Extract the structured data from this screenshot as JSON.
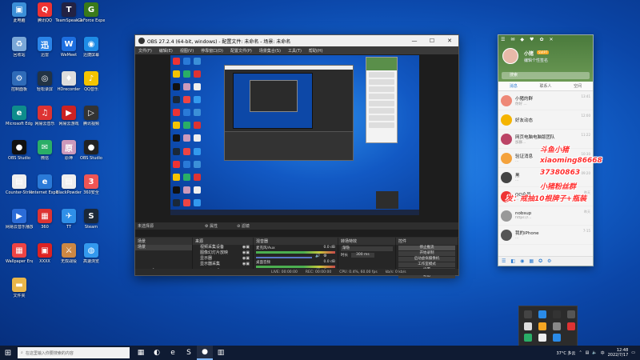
{
  "desktop": {
    "icons": [
      {
        "label": "此电脑",
        "color": "#3b8fd8",
        "glyph": "▣"
      },
      {
        "label": "腾讯QQ",
        "color": "#e33",
        "glyph": "Q"
      },
      {
        "label": "TeamSpeak 3",
        "color": "#224",
        "glyph": "T"
      },
      {
        "label": "GeForce Experience",
        "color": "#3a7a1a",
        "glyph": "G"
      },
      {
        "label": "回收站",
        "color": "#7aa7d8",
        "glyph": "♻"
      },
      {
        "label": "迅雷",
        "color": "#2a84e8",
        "glyph": "迅"
      },
      {
        "label": "WeMeet",
        "color": "#1d6fe0",
        "glyph": "W"
      },
      {
        "label": "迅捷屏幕",
        "color": "#1e8ce6",
        "glyph": "◉"
      },
      {
        "label": "控制面板",
        "color": "#2f6bb8",
        "glyph": "⚙"
      },
      {
        "label": "轻松录屏",
        "color": "#234",
        "glyph": "◎"
      },
      {
        "label": "HDrecorder",
        "color": "#ddd",
        "glyph": "♦"
      },
      {
        "label": "QQ音乐",
        "color": "#f5c400",
        "glyph": "♪"
      },
      {
        "label": "Microsoft Edge",
        "color": "#0e8c8c",
        "glyph": "e"
      },
      {
        "label": "网易云音乐",
        "color": "#d33",
        "glyph": "♫"
      },
      {
        "label": "网易云游戏",
        "color": "#c22",
        "glyph": "▶"
      },
      {
        "label": "腾讯视频",
        "color": "#333",
        "glyph": "▷"
      },
      {
        "label": "OBS Studio",
        "color": "#111",
        "glyph": "●"
      },
      {
        "label": "微信",
        "color": "#2aae67",
        "glyph": "✉"
      },
      {
        "label": "原神",
        "color": "#c9b",
        "glyph": "原"
      },
      {
        "label": "OBS Studio",
        "color": "#222",
        "glyph": "●"
      },
      {
        "label": "Counter-Strike",
        "color": "#eee",
        "glyph": "▤"
      },
      {
        "label": "Internet Explorer",
        "color": "#2a7ad8",
        "glyph": "e"
      },
      {
        "label": "BlackPowder",
        "color": "#eee",
        "glyph": "▤"
      },
      {
        "label": "360安全",
        "color": "#e55",
        "glyph": "3"
      },
      {
        "label": "网易云音乐播放器",
        "color": "#2b6cd8",
        "glyph": "▶"
      },
      {
        "label": "360",
        "color": "#d33",
        "glyph": "▦"
      },
      {
        "label": "TT",
        "color": "#2f8fe8",
        "glyph": "✈"
      },
      {
        "label": "Steam",
        "color": "#1b2838",
        "glyph": "S"
      },
      {
        "label": "Wallpaper Engine",
        "color": "#e44",
        "glyph": "▦"
      },
      {
        "label": "XXXX",
        "color": "#d22",
        "glyph": "▣"
      },
      {
        "label": "无双战役",
        "color": "#c84",
        "glyph": "⚔"
      },
      {
        "label": "高速浏览",
        "color": "#39e",
        "glyph": "◍"
      },
      {
        "label": "文件夹",
        "color": "#e9b64a",
        "glyph": "▬"
      }
    ]
  },
  "obs": {
    "title": "OBS 27.2.4 (64-bit, windows) - 配置文件: 未命名 - 场景: 未命名",
    "min": "—",
    "max": "☐",
    "close": "✕",
    "menu": [
      "文件(F)",
      "编辑(E)",
      "视图(V)",
      "停靠窗口(D)",
      "配置文件(P)",
      "场景集合(S)",
      "工具(T)",
      "帮助(H)"
    ],
    "scene_label": "未选择源",
    "props_btn": "⚙ 属性",
    "filter_btn": "⊘ 滤镜",
    "dock_headers": [
      "场景",
      "来源",
      "混音器",
      "转场特效",
      "控件"
    ],
    "scenes": [
      "场景"
    ],
    "sources": [
      "视频采集设备",
      "图像幻灯片放映",
      "显示器",
      "显示器采集"
    ],
    "mixer": [
      {
        "name": "麦克风/Aux",
        "db": "0.0 dB"
      },
      {
        "name": "桌面音频",
        "db": "0.0 dB"
      }
    ],
    "transition": {
      "type": "渐隐",
      "duration_label": "时长",
      "duration": "300 ms"
    },
    "controls": [
      "停止推流",
      "开始录制",
      "启动虚拟摄像机",
      "工作室模式",
      "设置",
      "退出"
    ],
    "status": {
      "live": "LIVE: 00:00:00",
      "rec": "REC: 00:00:00",
      "cpu": "CPU: 0.4%, 60.00 fps",
      "kbps": "kb/s: 0 kb/s"
    }
  },
  "qq": {
    "header_icons": [
      "☰",
      "✉",
      "◆",
      "♥",
      "✿",
      "✕"
    ],
    "nickname": "小猪",
    "vip": "SVIP7",
    "signature": "编辑个性签名",
    "search_placeholder": "搜索",
    "tabs": [
      "消息",
      "联系人",
      "空间"
    ],
    "chats": [
      {
        "name": "小猪的群",
        "preview": "你好 ...",
        "time": "13:41",
        "color": "#e87"
      },
      {
        "name": "好友动态",
        "preview": "",
        "time": "12:00",
        "color": "#f5b400"
      },
      {
        "name": "网页电脑电脑版团队",
        "preview": "加群...",
        "time": "11:22",
        "color": "#b46"
      },
      {
        "name": "验证消息",
        "preview": "...",
        "time": "10:30",
        "color": "#f4a23c"
      },
      {
        "name": "黑",
        "preview": "...",
        "time": "09:20",
        "color": "#444"
      },
      {
        "name": "QQ会员",
        "preview": "...",
        "time": "昨天",
        "color": "#e33"
      },
      {
        "name": "nobsup",
        "preview": "https://...",
        "time": "昨天",
        "color": "#999"
      },
      {
        "name": "我的iPhone",
        "preview": "...",
        "time": "7-15",
        "color": "#555"
      }
    ],
    "bottom_icons": [
      "☰",
      "◧",
      "◉",
      "▦",
      "✪",
      "⚙"
    ]
  },
  "danmu": [
    {
      "text": "斗鱼小猪"
    },
    {
      "text": "xiaoming86668"
    },
    {
      "text": "37380863"
    },
    {
      "text": "小猪粉丝群"
    },
    {
      "text": "发：戒抽10根牌子+瓶装"
    }
  ],
  "taskbar": {
    "start": "⊞",
    "search_placeholder": "在这里输入你要搜索的内容",
    "apps": [
      "▦",
      "◐",
      "e",
      "S",
      "●",
      "▥"
    ],
    "weather": "37°C 多云",
    "time": "12:48",
    "date": "2022/7/17"
  }
}
